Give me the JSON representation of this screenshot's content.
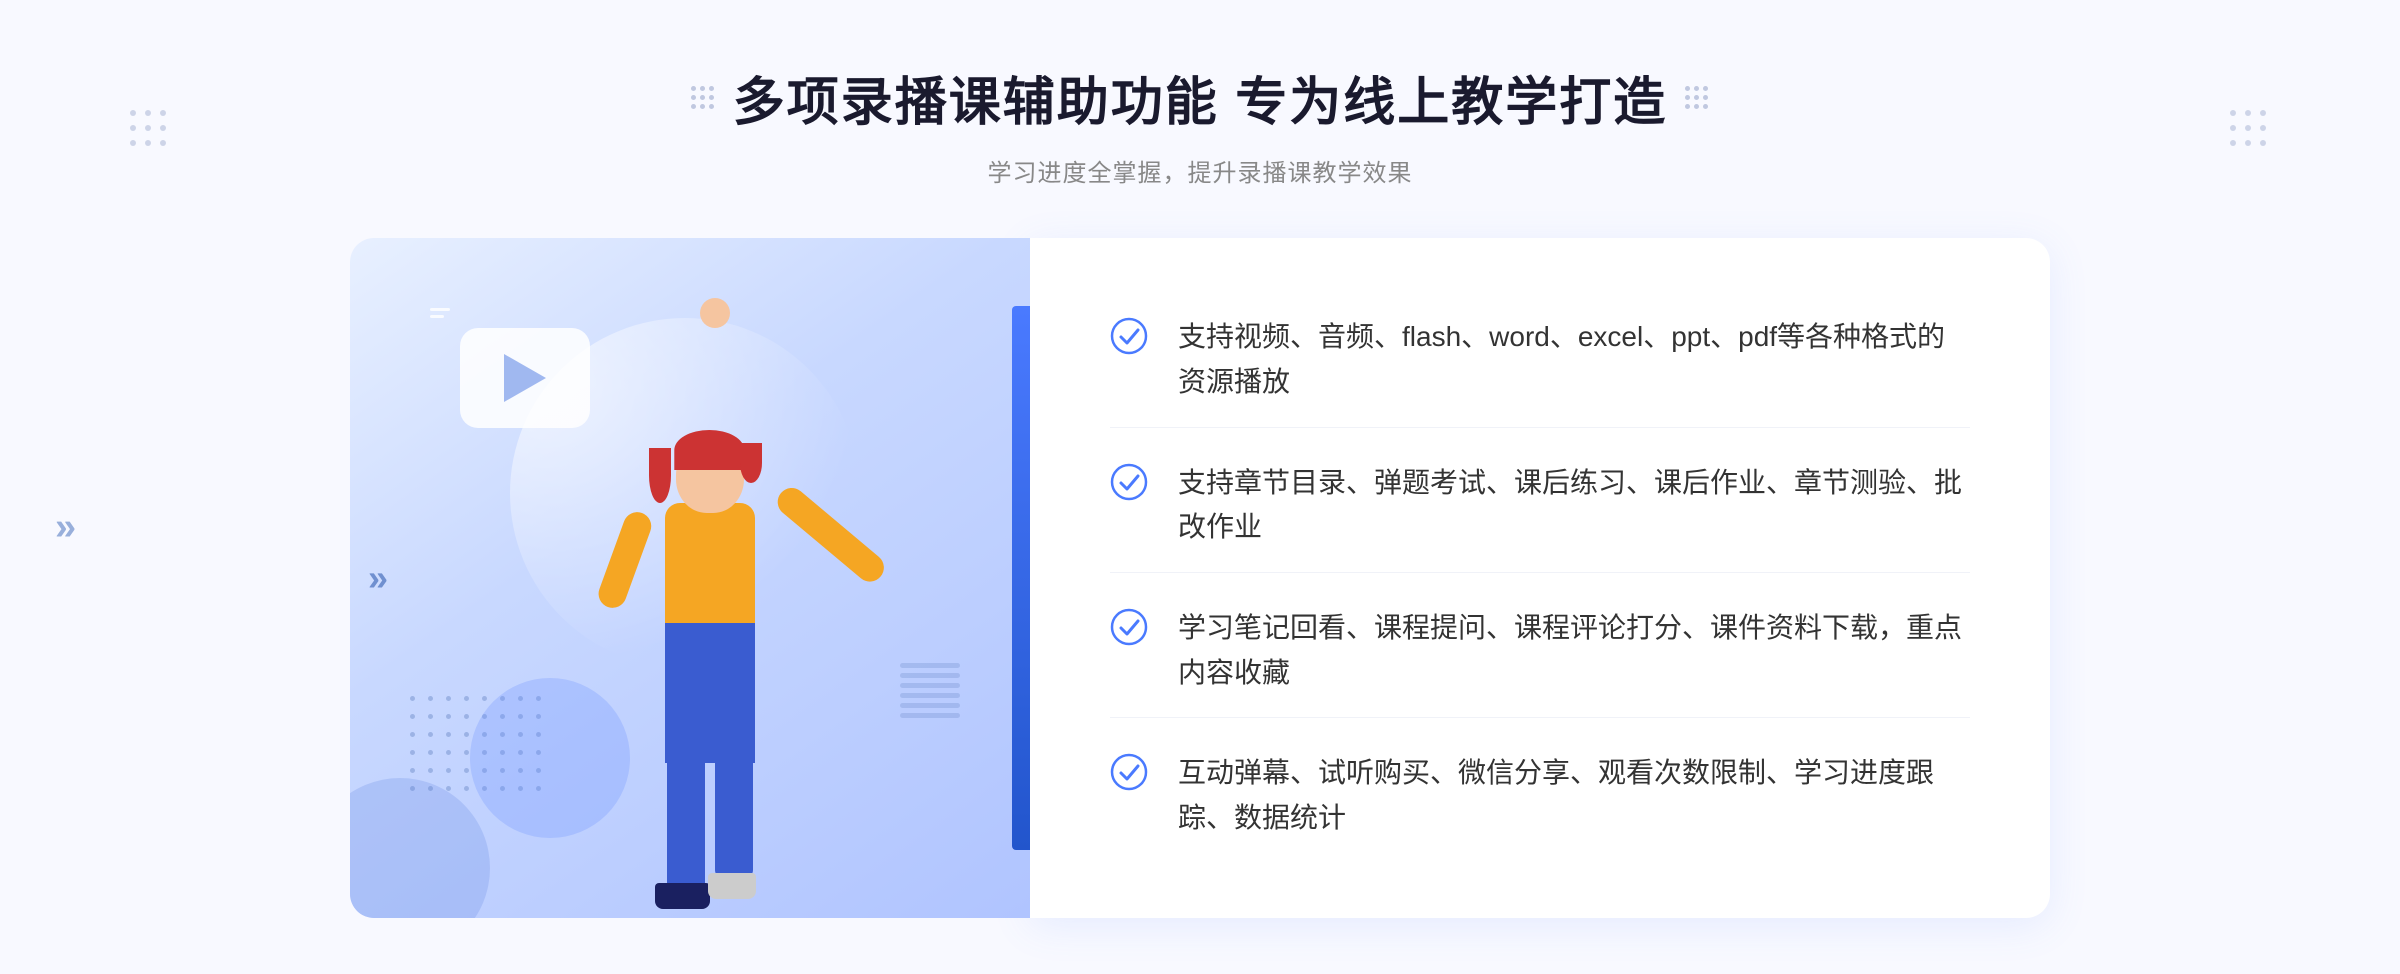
{
  "header": {
    "title": "多项录播课辅助功能 专为线上教学打造",
    "subtitle": "学习进度全掌握，提升录播课教学效果"
  },
  "features": [
    {
      "id": "feature-1",
      "text": "支持视频、音频、flash、word、excel、ppt、pdf等各种格式的资源播放"
    },
    {
      "id": "feature-2",
      "text": "支持章节目录、弹题考试、课后练习、课后作业、章节测验、批改作业"
    },
    {
      "id": "feature-3",
      "text": "学习笔记回看、课程提问、课程评论打分、课件资料下载，重点内容收藏"
    },
    {
      "id": "feature-4",
      "text": "互动弹幕、试听购买、微信分享、观看次数限制、学习进度跟踪、数据统计"
    }
  ],
  "decorations": {
    "dot_grid_label": "dot-grid-decoration",
    "arrow_symbol": "»",
    "check_color": "#4a7aff"
  }
}
